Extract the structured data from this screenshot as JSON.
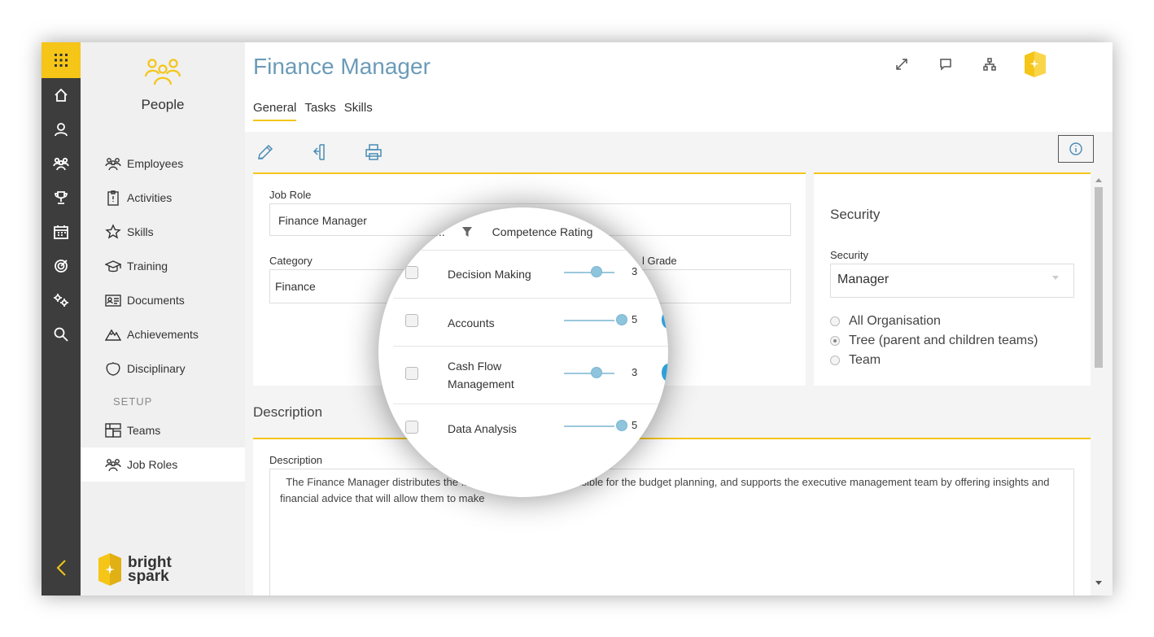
{
  "app": {
    "title": "People"
  },
  "header": {
    "title": "Finance Manager",
    "tabs": [
      {
        "label": "General"
      },
      {
        "label": "Tasks"
      },
      {
        "label": "Skills"
      }
    ]
  },
  "rail": {
    "icons": [
      "apps-grid-icon",
      "home-icon",
      "person-icon",
      "people-icon",
      "trophy-icon",
      "calendar-icon",
      "target-icon",
      "gears-icon",
      "search-icon"
    ]
  },
  "nav": {
    "items": [
      {
        "label": "Employees",
        "icon": "people-icon"
      },
      {
        "label": "Activities",
        "icon": "clipboard-icon"
      },
      {
        "label": "Skills",
        "icon": "star-icon"
      },
      {
        "label": "Training",
        "icon": "graduation-cap-icon"
      },
      {
        "label": "Documents",
        "icon": "id-card-icon"
      },
      {
        "label": "Achievements",
        "icon": "mountain-icon"
      },
      {
        "label": "Disciplinary",
        "icon": "shield-icon"
      }
    ],
    "setup_label": "SETUP",
    "setup_items": [
      {
        "label": "Teams",
        "icon": "org-icon"
      },
      {
        "label": "Job Roles",
        "icon": "people-icon"
      }
    ],
    "brand_line1": "bright",
    "brand_line2": "spark"
  },
  "form": {
    "job_role_label": "Job Role",
    "job_role_value": "Finance Manager",
    "category_label": "Category",
    "category_value": "Finance",
    "grade_label_partial": "l Grade",
    "security_heading": "Security",
    "security_label": "Security",
    "security_value": "Manager",
    "radio_options": [
      {
        "label": "All Organisation",
        "checked": false
      },
      {
        "label": "Tree (parent and children teams)",
        "checked": true
      },
      {
        "label": "Team",
        "checked": false
      }
    ],
    "description_heading": "Description",
    "description_label": "Description",
    "description_value": "  The Finance Manager distributes the ... the company, is responsible for the budget planning, and supports the executive management team by offering insights and financial advice that will allow them to make"
  },
  "magnifier": {
    "header_partial": "...",
    "header_label": "Competence Rating",
    "rows": [
      {
        "name": "Decision Making",
        "rating": 3
      },
      {
        "name": "Accounts",
        "rating": 5
      },
      {
        "name": "Cash Flow Management",
        "rating": 3
      },
      {
        "name": "Data Analysis",
        "rating": 5
      }
    ]
  },
  "colors": {
    "accent": "#f5c518",
    "title": "#6b9bb8",
    "icon_blue": "#4a8bb5",
    "rail": "#3d3d3d"
  }
}
